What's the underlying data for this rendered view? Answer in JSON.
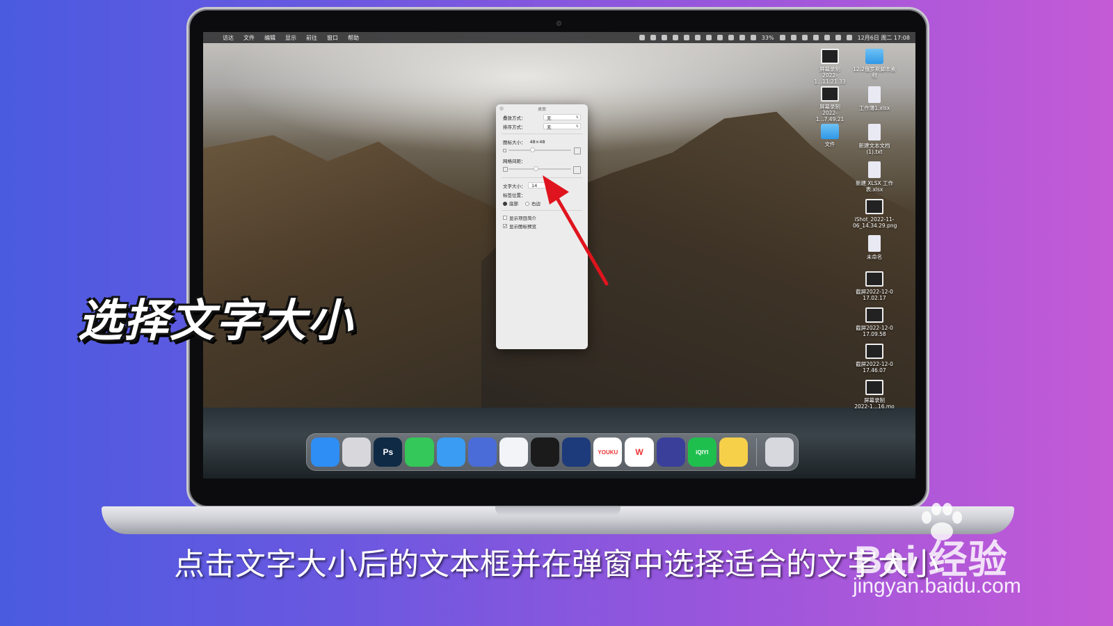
{
  "menubar": {
    "apple": "",
    "items": [
      "访达",
      "文件",
      "编辑",
      "显示",
      "前往",
      "窗口",
      "帮助"
    ],
    "battery": "33%",
    "datetime": "12月6日 周二 17:08"
  },
  "desktop_icons": [
    {
      "label": "屏幕录制\n2022-1...11.21.33",
      "kind": "screenshot"
    },
    {
      "label": "12.2俄罗斯脚本素材",
      "kind": "folder"
    },
    {
      "label": "屏幕录制\n2022-1...7.49.21",
      "kind": "screenshot"
    },
    {
      "label": "工作薄1.xlsx",
      "kind": "doc"
    },
    {
      "label": "文件",
      "kind": "folder"
    },
    {
      "label": "新建文本文档 (1).txt",
      "kind": "doc"
    },
    {
      "label": "新建 XLSX 工作表.xlsx",
      "kind": "doc"
    },
    {
      "label": "iShot_2022-11-06_14.34.29.png",
      "kind": "screenshot"
    },
    {
      "label": "未命名",
      "kind": "doc"
    },
    {
      "label": "截屏2022-12-0\n17.02.17",
      "kind": "screenshot"
    },
    {
      "label": "截屏2022-12-0\n17.09.58",
      "kind": "screenshot"
    },
    {
      "label": "截屏2022-12-0\n17.46.07",
      "kind": "screenshot"
    },
    {
      "label": "屏幕录制\n2022-1...16.mo",
      "kind": "screenshot"
    }
  ],
  "dialog": {
    "title": "桌面",
    "stack_label": "叠放方式：",
    "stack_value": "无",
    "sort_label": "排序方式：",
    "sort_value": "无",
    "icon_size_label": "图标大小：",
    "icon_size_value": "48×48",
    "grid_label": "网格间距：",
    "text_size_label": "文字大小：",
    "text_size_value": "14",
    "label_pos_label": "标签位置：",
    "label_bottom": "底部",
    "label_right": "右边",
    "show_info": "显示项目简介",
    "show_preview": "显示图标预览"
  },
  "dock": {
    "apps": [
      {
        "name": "finder",
        "label": "",
        "color": "#2e8ef5"
      },
      {
        "name": "launchpad",
        "label": "",
        "color": "#d8d8dc"
      },
      {
        "name": "photoshop",
        "label": "Ps",
        "color": "#0f2a45"
      },
      {
        "name": "messages",
        "label": "",
        "color": "#34c759"
      },
      {
        "name": "safari",
        "label": "",
        "color": "#3a9cf3"
      },
      {
        "name": "quicktime",
        "label": "",
        "color": "#4a6cd8"
      },
      {
        "name": "lark",
        "label": "",
        "color": "#f2f4f8"
      },
      {
        "name": "qq",
        "label": "",
        "color": "#1b1b1b"
      },
      {
        "name": "infuse",
        "label": "",
        "color": "#1d3a7a"
      },
      {
        "name": "youku",
        "label": "YOUKU",
        "color": "#ffffff"
      },
      {
        "name": "wps",
        "label": "W",
        "color": "#ffffff"
      },
      {
        "name": "shortcuts",
        "label": "",
        "color": "#3a3f9a"
      },
      {
        "name": "iqiyi",
        "label": "iQIYI",
        "color": "#1fbf4e"
      },
      {
        "name": "notes",
        "label": "",
        "color": "#f7d04a"
      },
      {
        "name": "trash",
        "label": "",
        "color": "#d6d8de"
      }
    ]
  },
  "caption": {
    "title": "选择文字大小",
    "subtitle": "点击文字大小后的文本框并在弹窗中选择适合的文字大小"
  },
  "watermark": {
    "brand": "Bai 经验",
    "url": "jingyan.baidu.com"
  },
  "colors": {
    "arrow": "#e0141e",
    "bg_left": "#4a5be0",
    "bg_right": "#c45ad6"
  }
}
